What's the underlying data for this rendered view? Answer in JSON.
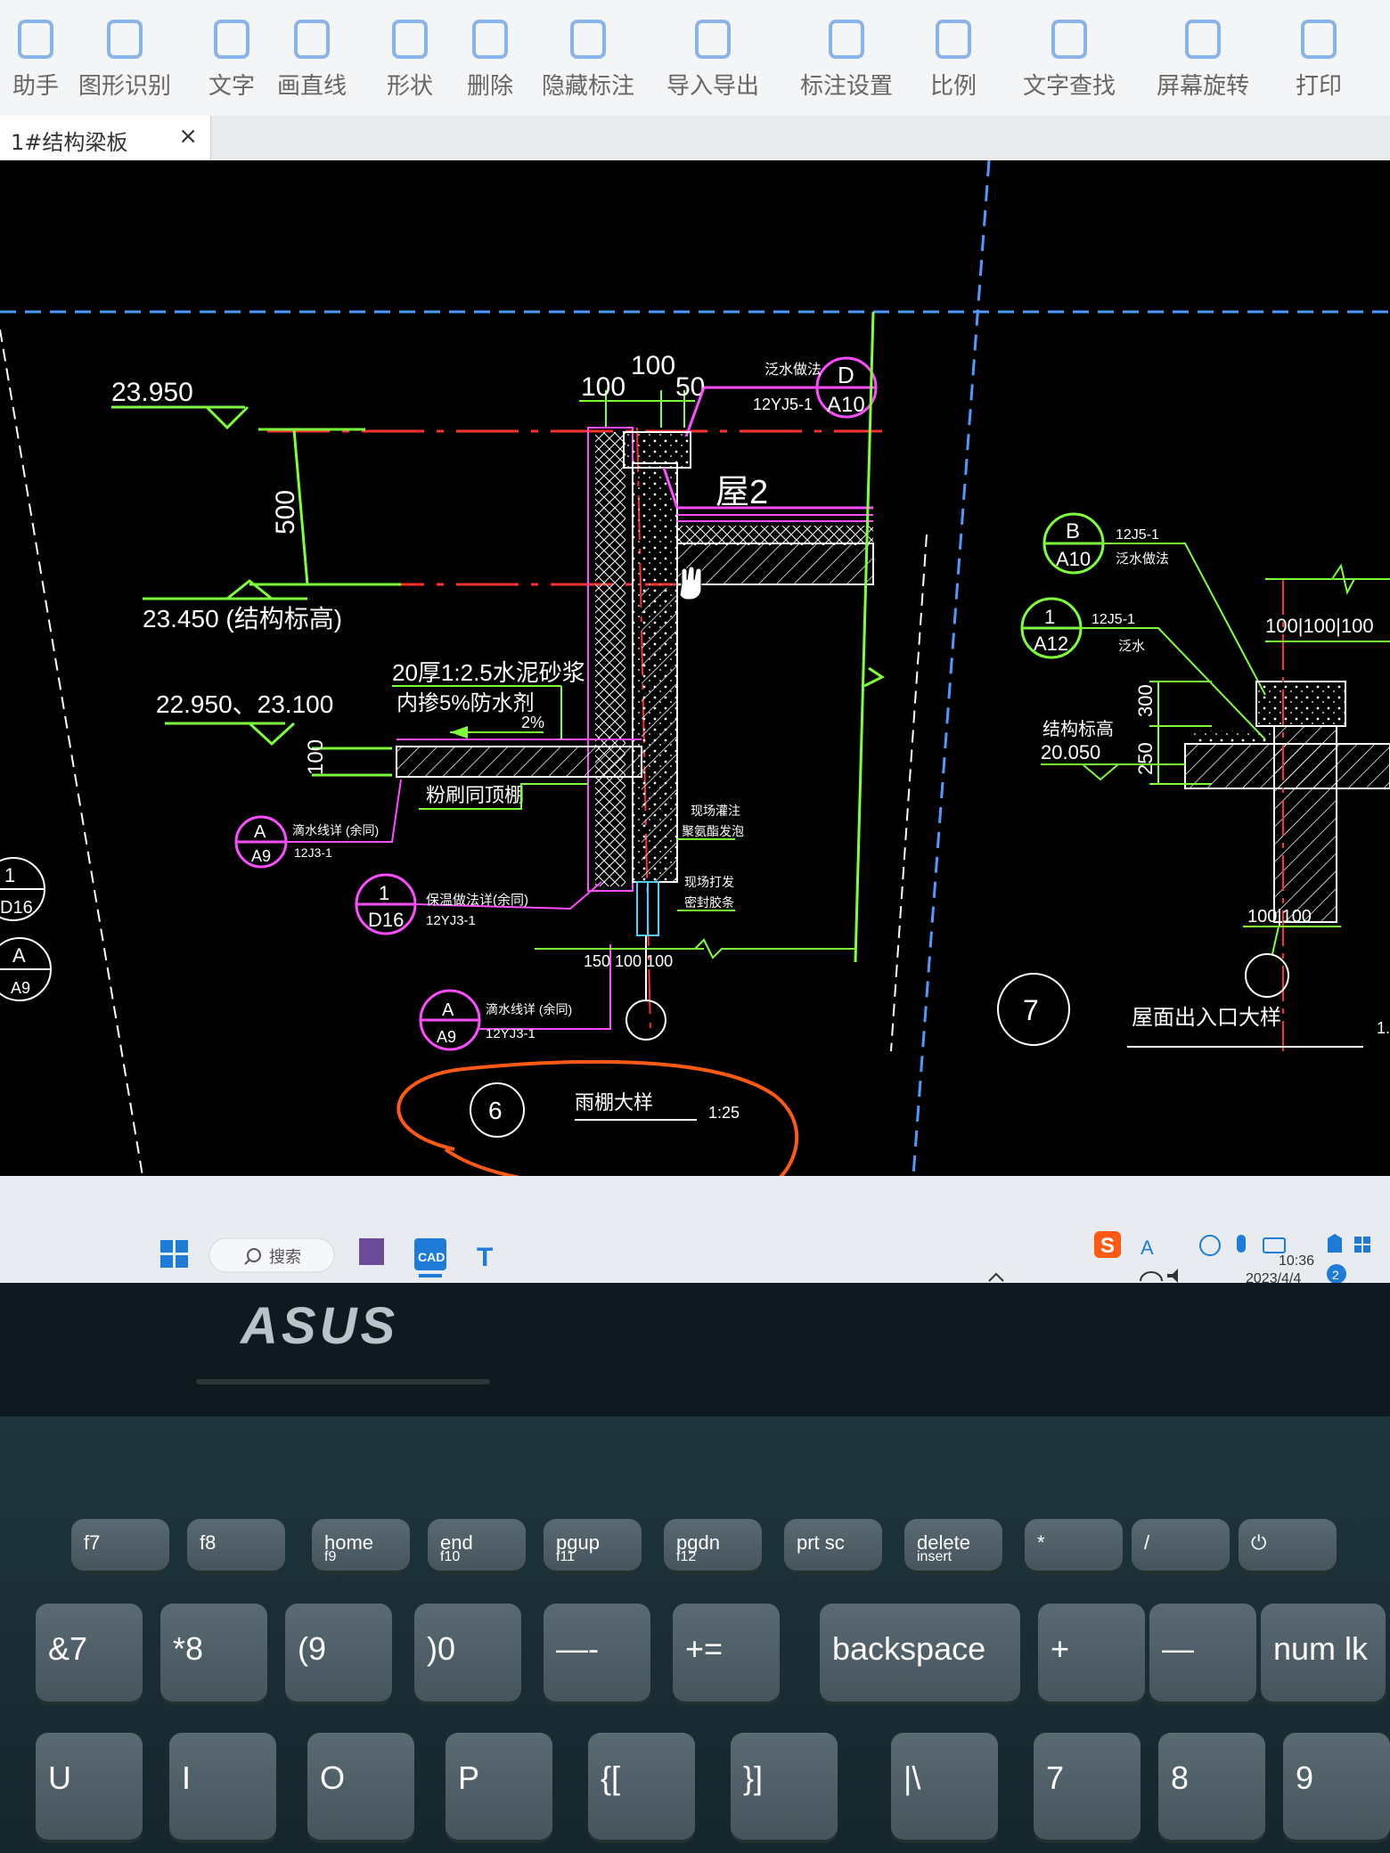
{
  "toolbar": {
    "items": [
      {
        "label": "助手",
        "icon": "assistant-icon"
      },
      {
        "label": "图形识别",
        "icon": "shape-recognition-icon"
      },
      {
        "label": "文字",
        "icon": "text-icon"
      },
      {
        "label": "画直线",
        "icon": "draw-line-icon"
      },
      {
        "label": "形状",
        "icon": "shape-icon"
      },
      {
        "label": "删除",
        "icon": "eraser-icon"
      },
      {
        "label": "隐藏标注",
        "icon": "hide-annotation-icon"
      },
      {
        "label": "导入导出",
        "icon": "import-export-icon"
      },
      {
        "label": "标注设置",
        "icon": "annotation-settings-icon"
      },
      {
        "label": "比例",
        "icon": "scale-icon"
      },
      {
        "label": "文字查找",
        "icon": "text-search-icon"
      },
      {
        "label": "屏幕旋转",
        "icon": "screen-rotate-icon"
      },
      {
        "label": "打印",
        "icon": "print-icon"
      }
    ]
  },
  "tab": {
    "title": "1#结构梁板",
    "close": "×"
  },
  "drawing": {
    "elev_top": "23.950",
    "dim_500": "500",
    "elev_struct": "23.450 (结构标高)",
    "elev_low": "22.950、23.100",
    "dim_100_side": "100",
    "dim_top_left": "100",
    "dim_top_mid": "100",
    "dim_top_right": "50",
    "d_ref_note": "泛水做法",
    "d_ref_std": "12YJ5-1",
    "d_ref_top": "D",
    "d_ref_bottom": "A10",
    "wu2": "屋2",
    "mortar_1": "20厚1:2.5水泥砂浆",
    "mortar_2": "内掺5%防水剂",
    "slope": "2%",
    "ceiling": "粉刷同顶棚",
    "a9_top": "A",
    "a9_bottom": "A9",
    "a9_note": "滴水线详 (余同)",
    "a9_std": "12J3-1",
    "d16_top": "1",
    "d16_bottom": "D16",
    "d16_note": "保温做法详(余同)",
    "d16_std": "12YJ3-1",
    "a9b_top": "A",
    "a9b_bottom": "A9",
    "a9b_note": "滴水线详 (余同)",
    "a9b_std": "12YJ3-1",
    "note_wall1": "现场灌注",
    "note_wall2": "聚氨酯发泡",
    "note_wall3": "现场打发",
    "note_wall4": "密封胶条",
    "dim_bottom": "150 100 100",
    "detail_num": "6",
    "detail_title": "雨棚大样",
    "detail_scale": "1:25",
    "b_ref_top": "B",
    "b_ref_bottom": "A10",
    "b_ref_std": "12J5-1",
    "b_ref_note": "泛水做法",
    "r1_top": "1",
    "r1_bottom": "A12",
    "r1_std": "12J5-1",
    "r1_note": "泛水",
    "struct_label": "结构标高",
    "struct_elev": "20.050",
    "dim_300": "300",
    "dim_250": "250",
    "dim_top_right_group": "100|100|100",
    "dim_bot_right_group": "100|100",
    "detail7_num": "7",
    "detail7_title": "屋面出入口大样",
    "left_1_top": "1",
    "left_1_bottom": "D16",
    "left_a_top": "A",
    "left_a_bottom": "A9",
    "edge_fragment": "1."
  },
  "taskbar": {
    "search": "搜索",
    "ime": "S",
    "ime_lang": "A",
    "time": "10:36",
    "date": "2023/4/4",
    "notif_count": "2"
  },
  "laptop": {
    "brand": "ASUS"
  },
  "keyboard": {
    "fn_row": [
      "f7",
      "f8",
      "home",
      "end",
      "pgup",
      "pgdn",
      "prt sc",
      "delete",
      "*",
      "/",
      "⏻"
    ],
    "fn_sub": [
      "",
      "",
      "f9",
      "f10",
      "f11",
      "f12",
      "",
      "insert",
      "",
      "",
      ""
    ],
    "num_row": [
      "&7",
      "*8",
      "(9",
      ")0",
      "—-",
      "+=",
      "backspace",
      "+",
      "—"
    ],
    "num_lk": "num lk",
    "letter_row": [
      "U",
      "I",
      "O",
      "P",
      "{[",
      "}]",
      "|\\",
      "7",
      "8",
      "9"
    ]
  },
  "colors": {
    "green": "#7dff3c",
    "red": "#ff3030",
    "magenta": "#ff4cff",
    "white": "#ffffff",
    "blue_dash": "#4d9bff",
    "orange_circle": "#ff5a14"
  }
}
